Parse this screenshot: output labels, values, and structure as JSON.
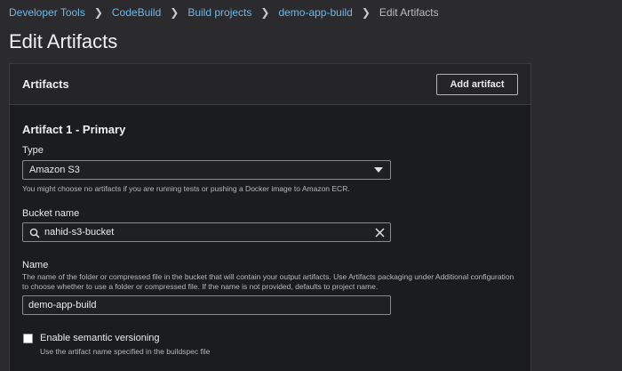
{
  "breadcrumb": {
    "items": [
      "Developer Tools",
      "CodeBuild",
      "Build projects",
      "demo-app-build"
    ],
    "current": "Edit Artifacts"
  },
  "page": {
    "title": "Edit Artifacts"
  },
  "panel": {
    "title": "Artifacts",
    "add_button_label": "Add artifact"
  },
  "artifact": {
    "section_title": "Artifact 1 - Primary",
    "type": {
      "label": "Type",
      "selected": "Amazon S3",
      "help": "You might choose no artifacts if you are running tests or pushing a Docker image to Amazon ECR."
    },
    "bucket": {
      "label": "Bucket name",
      "value": "nahid-s3-bucket"
    },
    "name": {
      "label": "Name",
      "help": "The name of the folder or compressed file in the bucket that will contain your output artifacts. Use Artifacts packaging under Additional configuration to choose whether to use a folder or compressed file. If the name is not provided, defaults to project name.",
      "value": "demo-app-build"
    },
    "semantic_versioning": {
      "label": "Enable semantic versioning",
      "help": "Use the artifact name specified in the buildspec file",
      "checked": false
    }
  }
}
